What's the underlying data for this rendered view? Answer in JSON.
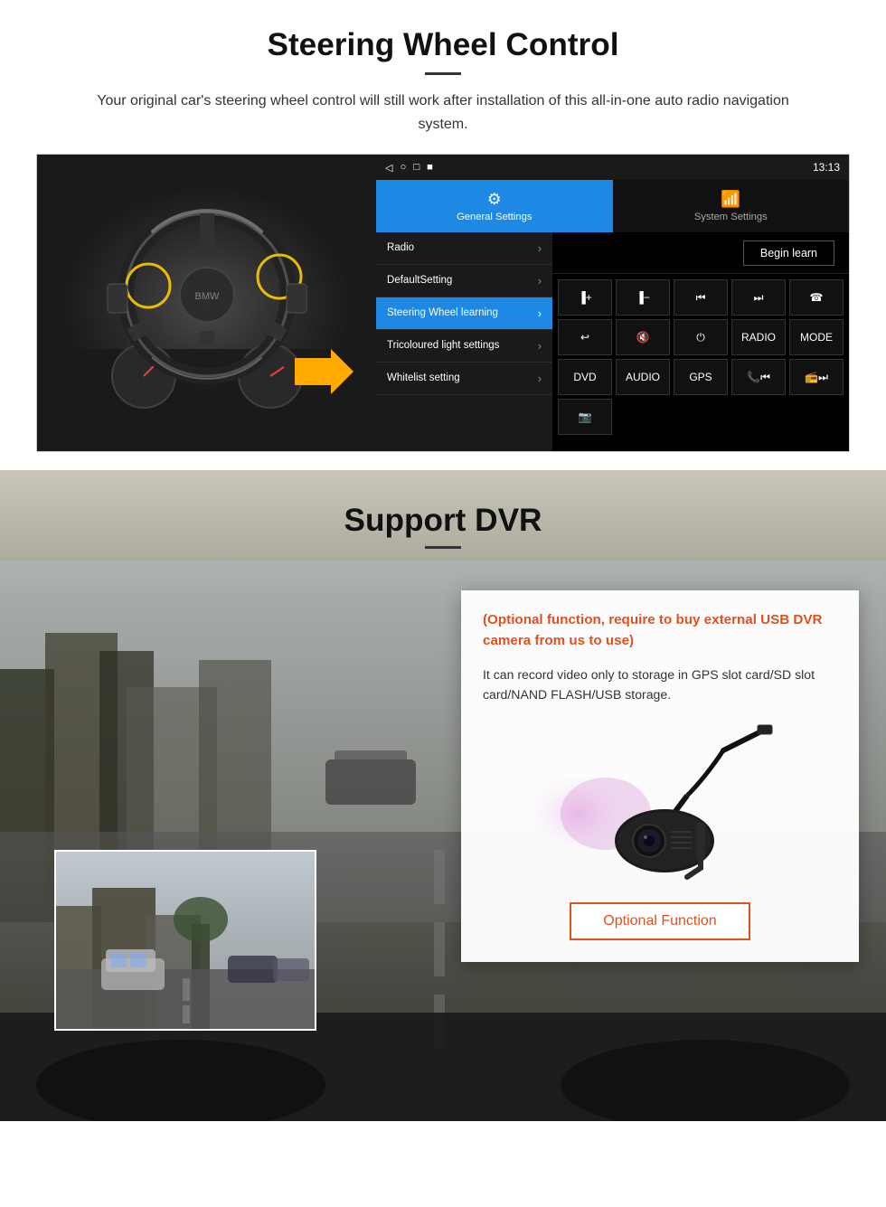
{
  "steering": {
    "title": "Steering Wheel Control",
    "description": "Your original car's steering wheel control will still work after installation of this all-in-one auto radio navigation system.",
    "status_bar": {
      "time": "13:13",
      "icons": [
        "◁",
        "○",
        "□",
        "■"
      ]
    },
    "tabs": {
      "general": "General Settings",
      "system": "System Settings"
    },
    "menu": [
      {
        "label": "Radio",
        "active": false
      },
      {
        "label": "DefaultSetting",
        "active": false
      },
      {
        "label": "Steering Wheel learning",
        "active": true
      },
      {
        "label": "Tricoloured light settings",
        "active": false
      },
      {
        "label": "Whitelist setting",
        "active": false
      }
    ],
    "begin_learn": "Begin learn",
    "control_buttons": [
      "▐+",
      "▐−",
      "⏮",
      "⏭",
      "☎",
      "↩",
      "🔇",
      "⏻",
      "RADIO",
      "MODE",
      "DVD",
      "AUDIO",
      "GPS",
      "📞⏮",
      "⏭"
    ]
  },
  "dvr": {
    "title": "Support DVR",
    "optional_text": "(Optional function, require to buy external USB DVR camera from us to use)",
    "body_text": "It can record video only to storage in GPS slot card/SD slot card/NAND FLASH/USB storage.",
    "optional_button": "Optional Function"
  }
}
